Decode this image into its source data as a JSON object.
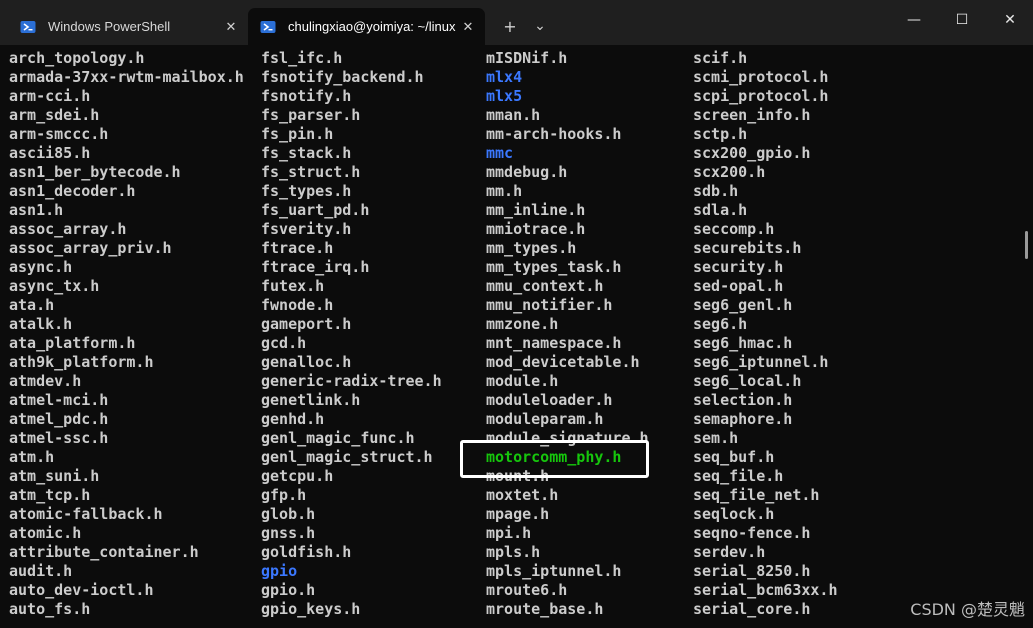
{
  "tabs": [
    {
      "label": "Windows PowerShell",
      "icon": "powershell-icon",
      "active": false
    },
    {
      "label": "chulingxiao@yoimiya: ~/linux",
      "icon": "powershell-icon",
      "active": true
    }
  ],
  "tab_close_glyph": "✕",
  "new_tab_glyph": "+",
  "dropdown_glyph": "⌄",
  "window_controls": {
    "minimize": "—",
    "maximize": "☐",
    "close": "✕"
  },
  "colors": {
    "file": "#cccccc",
    "directory": "#3b78ff",
    "executable": "#16c60c",
    "background": "#0c0c0c"
  },
  "columns": [
    [
      {
        "name": "arch_topology.h",
        "type": "file"
      },
      {
        "name": "armada-37xx-rwtm-mailbox.h",
        "type": "file"
      },
      {
        "name": "arm-cci.h",
        "type": "file"
      },
      {
        "name": "arm_sdei.h",
        "type": "file"
      },
      {
        "name": "arm-smccc.h",
        "type": "file"
      },
      {
        "name": "ascii85.h",
        "type": "file"
      },
      {
        "name": "asn1_ber_bytecode.h",
        "type": "file"
      },
      {
        "name": "asn1_decoder.h",
        "type": "file"
      },
      {
        "name": "asn1.h",
        "type": "file"
      },
      {
        "name": "assoc_array.h",
        "type": "file"
      },
      {
        "name": "assoc_array_priv.h",
        "type": "file"
      },
      {
        "name": "async.h",
        "type": "file"
      },
      {
        "name": "async_tx.h",
        "type": "file"
      },
      {
        "name": "ata.h",
        "type": "file"
      },
      {
        "name": "atalk.h",
        "type": "file"
      },
      {
        "name": "ata_platform.h",
        "type": "file"
      },
      {
        "name": "ath9k_platform.h",
        "type": "file"
      },
      {
        "name": "atmdev.h",
        "type": "file"
      },
      {
        "name": "atmel-mci.h",
        "type": "file"
      },
      {
        "name": "atmel_pdc.h",
        "type": "file"
      },
      {
        "name": "atmel-ssc.h",
        "type": "file"
      },
      {
        "name": "atm.h",
        "type": "file"
      },
      {
        "name": "atm_suni.h",
        "type": "file"
      },
      {
        "name": "atm_tcp.h",
        "type": "file"
      },
      {
        "name": "atomic-fallback.h",
        "type": "file"
      },
      {
        "name": "atomic.h",
        "type": "file"
      },
      {
        "name": "attribute_container.h",
        "type": "file"
      },
      {
        "name": "audit.h",
        "type": "file"
      },
      {
        "name": "auto_dev-ioctl.h",
        "type": "file"
      },
      {
        "name": "auto_fs.h",
        "type": "file"
      }
    ],
    [
      {
        "name": "fsl_ifc.h",
        "type": "file"
      },
      {
        "name": "fsnotify_backend.h",
        "type": "file"
      },
      {
        "name": "fsnotify.h",
        "type": "file"
      },
      {
        "name": "fs_parser.h",
        "type": "file"
      },
      {
        "name": "fs_pin.h",
        "type": "file"
      },
      {
        "name": "fs_stack.h",
        "type": "file"
      },
      {
        "name": "fs_struct.h",
        "type": "file"
      },
      {
        "name": "fs_types.h",
        "type": "file"
      },
      {
        "name": "fs_uart_pd.h",
        "type": "file"
      },
      {
        "name": "fsverity.h",
        "type": "file"
      },
      {
        "name": "ftrace.h",
        "type": "file"
      },
      {
        "name": "ftrace_irq.h",
        "type": "file"
      },
      {
        "name": "futex.h",
        "type": "file"
      },
      {
        "name": "fwnode.h",
        "type": "file"
      },
      {
        "name": "gameport.h",
        "type": "file"
      },
      {
        "name": "gcd.h",
        "type": "file"
      },
      {
        "name": "genalloc.h",
        "type": "file"
      },
      {
        "name": "generic-radix-tree.h",
        "type": "file"
      },
      {
        "name": "genetlink.h",
        "type": "file"
      },
      {
        "name": "genhd.h",
        "type": "file"
      },
      {
        "name": "genl_magic_func.h",
        "type": "file"
      },
      {
        "name": "genl_magic_struct.h",
        "type": "file"
      },
      {
        "name": "getcpu.h",
        "type": "file"
      },
      {
        "name": "gfp.h",
        "type": "file"
      },
      {
        "name": "glob.h",
        "type": "file"
      },
      {
        "name": "gnss.h",
        "type": "file"
      },
      {
        "name": "goldfish.h",
        "type": "file"
      },
      {
        "name": "gpio",
        "type": "dir"
      },
      {
        "name": "gpio.h",
        "type": "file"
      },
      {
        "name": "gpio_keys.h",
        "type": "file"
      }
    ],
    [
      {
        "name": "mISDNif.h",
        "type": "file"
      },
      {
        "name": "mlx4",
        "type": "dir"
      },
      {
        "name": "mlx5",
        "type": "dir"
      },
      {
        "name": "mman.h",
        "type": "file"
      },
      {
        "name": "mm-arch-hooks.h",
        "type": "file"
      },
      {
        "name": "mmc",
        "type": "dir"
      },
      {
        "name": "mmdebug.h",
        "type": "file"
      },
      {
        "name": "mm.h",
        "type": "file"
      },
      {
        "name": "mm_inline.h",
        "type": "file"
      },
      {
        "name": "mmiotrace.h",
        "type": "file"
      },
      {
        "name": "mm_types.h",
        "type": "file"
      },
      {
        "name": "mm_types_task.h",
        "type": "file"
      },
      {
        "name": "mmu_context.h",
        "type": "file"
      },
      {
        "name": "mmu_notifier.h",
        "type": "file"
      },
      {
        "name": "mmzone.h",
        "type": "file"
      },
      {
        "name": "mnt_namespace.h",
        "type": "file"
      },
      {
        "name": "mod_devicetable.h",
        "type": "file"
      },
      {
        "name": "module.h",
        "type": "file"
      },
      {
        "name": "moduleloader.h",
        "type": "file"
      },
      {
        "name": "moduleparam.h",
        "type": "file"
      },
      {
        "name": "module_signature.h",
        "type": "file"
      },
      {
        "name": "motorcomm_phy.h",
        "type": "exe"
      },
      {
        "name": "mount.h",
        "type": "file"
      },
      {
        "name": "moxtet.h",
        "type": "file"
      },
      {
        "name": "mpage.h",
        "type": "file"
      },
      {
        "name": "mpi.h",
        "type": "file"
      },
      {
        "name": "mpls.h",
        "type": "file"
      },
      {
        "name": "mpls_iptunnel.h",
        "type": "file"
      },
      {
        "name": "mroute6.h",
        "type": "file"
      },
      {
        "name": "mroute_base.h",
        "type": "file"
      }
    ],
    [
      {
        "name": "scif.h",
        "type": "file"
      },
      {
        "name": "scmi_protocol.h",
        "type": "file"
      },
      {
        "name": "scpi_protocol.h",
        "type": "file"
      },
      {
        "name": "screen_info.h",
        "type": "file"
      },
      {
        "name": "sctp.h",
        "type": "file"
      },
      {
        "name": "scx200_gpio.h",
        "type": "file"
      },
      {
        "name": "scx200.h",
        "type": "file"
      },
      {
        "name": "sdb.h",
        "type": "file"
      },
      {
        "name": "sdla.h",
        "type": "file"
      },
      {
        "name": "seccomp.h",
        "type": "file"
      },
      {
        "name": "securebits.h",
        "type": "file"
      },
      {
        "name": "security.h",
        "type": "file"
      },
      {
        "name": "sed-opal.h",
        "type": "file"
      },
      {
        "name": "seg6_genl.h",
        "type": "file"
      },
      {
        "name": "seg6.h",
        "type": "file"
      },
      {
        "name": "seg6_hmac.h",
        "type": "file"
      },
      {
        "name": "seg6_iptunnel.h",
        "type": "file"
      },
      {
        "name": "seg6_local.h",
        "type": "file"
      },
      {
        "name": "selection.h",
        "type": "file"
      },
      {
        "name": "semaphore.h",
        "type": "file"
      },
      {
        "name": "sem.h",
        "type": "file"
      },
      {
        "name": "seq_buf.h",
        "type": "file"
      },
      {
        "name": "seq_file.h",
        "type": "file"
      },
      {
        "name": "seq_file_net.h",
        "type": "file"
      },
      {
        "name": "seqlock.h",
        "type": "file"
      },
      {
        "name": "seqno-fence.h",
        "type": "file"
      },
      {
        "name": "serdev.h",
        "type": "file"
      },
      {
        "name": "serial_8250.h",
        "type": "file"
      },
      {
        "name": "serial_bcm63xx.h",
        "type": "file"
      },
      {
        "name": "serial_core.h",
        "type": "file"
      }
    ]
  ],
  "watermark": "CSDN @楚灵魈"
}
